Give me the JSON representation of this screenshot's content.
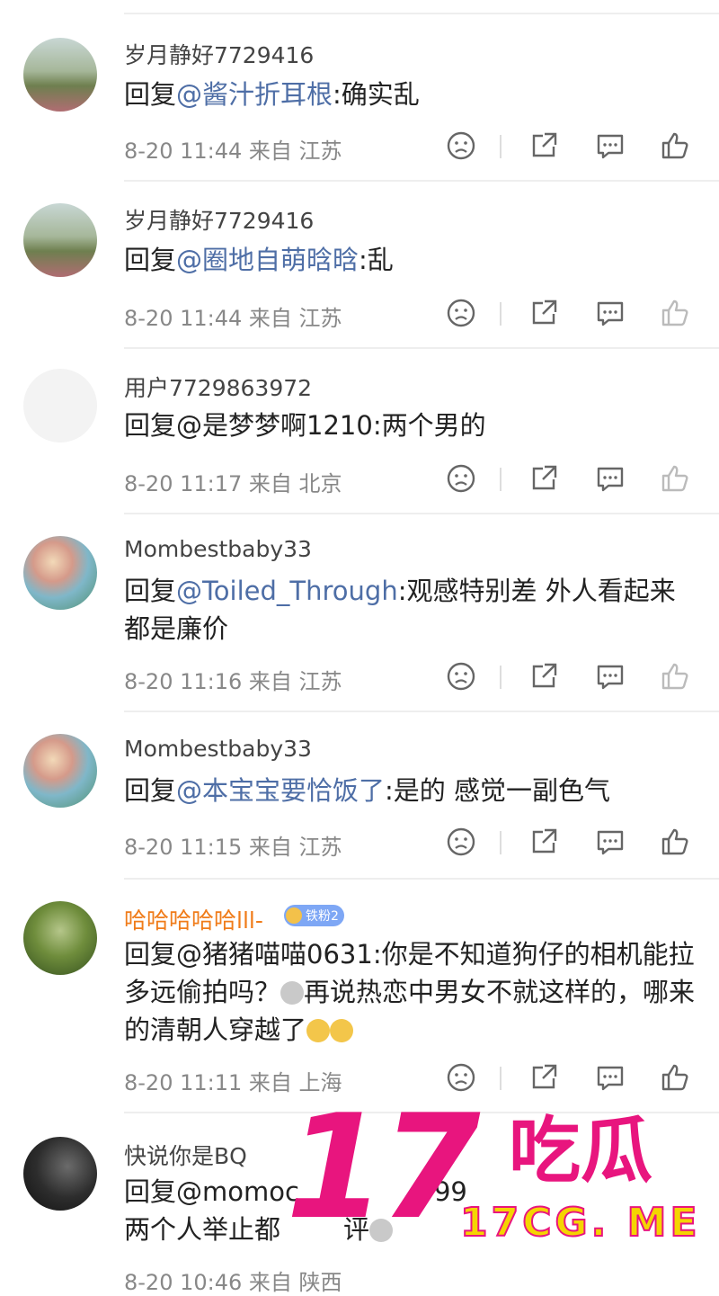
{
  "comments": [
    {
      "user": "岁月静好7729416",
      "reply_prefix": "回复",
      "mention": "@酱汁折耳根",
      "content": ":确实乱",
      "time": "8-20 11:44",
      "location": "来自 江苏",
      "avatar": "landscape"
    },
    {
      "user": "岁月静好7729416",
      "reply_prefix": "回复",
      "mention": "@圈地自萌晗晗",
      "content": ":乱",
      "time": "8-20 11:44",
      "location": "来自 江苏",
      "avatar": "landscape"
    },
    {
      "user": "用户7729863972",
      "reply_prefix": "回复",
      "mention": "",
      "content": "@是梦梦啊1210:两个男的",
      "time": "8-20 11:17",
      "location": "来自 北京",
      "avatar": "blank"
    },
    {
      "user": "Mombestbaby33",
      "reply_prefix": "回复",
      "mention": "@Toiled_Through",
      "content": ":观感特别差 外人看起来  都是廉价",
      "time": "8-20 11:16",
      "location": "来自 江苏",
      "avatar": "cartoon"
    },
    {
      "user": "Mombestbaby33",
      "reply_prefix": "回复",
      "mention": "@本宝宝要恰饭了",
      "content": ":是的 感觉一副色气",
      "time": "8-20 11:15",
      "location": "来自 江苏",
      "avatar": "cartoon"
    },
    {
      "user": "哈哈哈哈哈lll-",
      "badge": "铁粉2",
      "reply_prefix": "回复",
      "mention": "",
      "content_a": "@猪猪喵喵0631:你是不知道狗仔的相机能拉多远偷拍吗？",
      "content_b": "再说热恋中男女不就这样的，哪来的清朝人穿越了",
      "time": "8-20 11:11",
      "location": "来自 上海",
      "avatar": "tree"
    },
    {
      "user": "快说你是BQ",
      "reply_prefix": "回复",
      "mention": "",
      "content_a": "@momoc",
      "content_b": "99",
      "content_c": "两个人举止都",
      "content_d": "评",
      "time": "8-20 10:46",
      "location": "来自 陕西",
      "avatar": "dark"
    }
  ],
  "watermark": {
    "big": "17",
    "sub": "吃瓜",
    "url": "17CG. ME"
  },
  "colors": {
    "accent": "#e8157e",
    "mention": "#4e6ea6",
    "vip": "#f07c1a"
  }
}
